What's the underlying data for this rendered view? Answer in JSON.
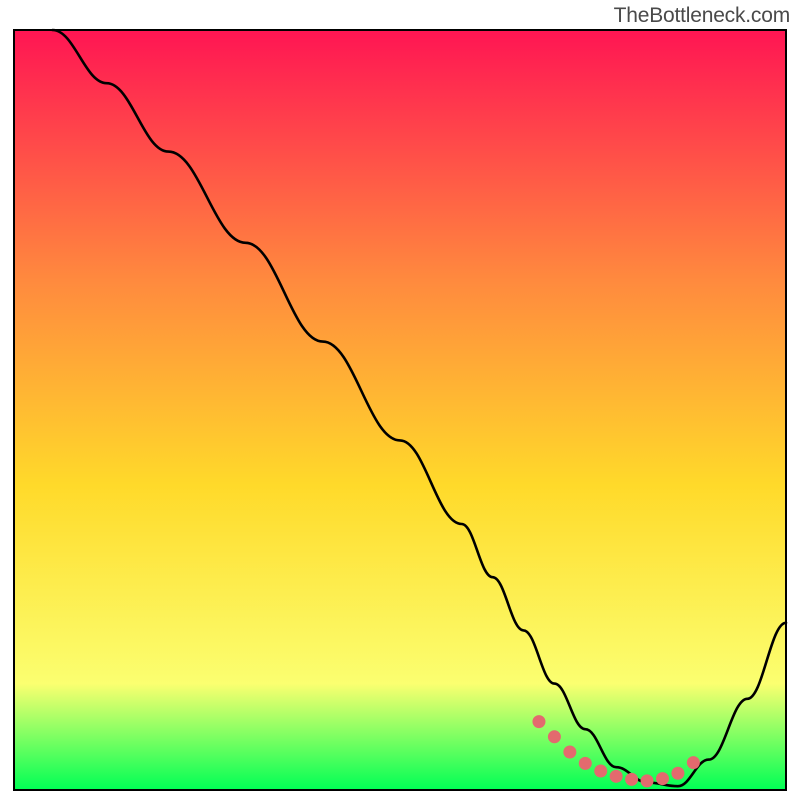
{
  "watermark": "TheBottleneck.com",
  "colors": {
    "curve_stroke": "#000000",
    "dotted_stroke": "#e36a6e",
    "gradient": {
      "top": "#ff1553",
      "upper_mid": "#ff8a3e",
      "mid": "#ffda2a",
      "lower_mid": "#fbff70",
      "bottom": "#00ff55"
    },
    "plot_border": "#000000",
    "page_bg": "#ffffff"
  },
  "chart_data": {
    "type": "line",
    "title": "",
    "xlabel": "",
    "ylabel": "",
    "xlim": [
      0,
      100
    ],
    "ylim": [
      0,
      100
    ],
    "grid": false,
    "legend": false,
    "series": [
      {
        "name": "bottleneck-curve",
        "x": [
          5,
          12,
          20,
          30,
          40,
          50,
          58,
          62,
          66,
          70,
          74,
          78,
          82,
          86,
          90,
          95,
          100
        ],
        "y": [
          100,
          93,
          84,
          72,
          59,
          46,
          35,
          28,
          21,
          14,
          8,
          3,
          1,
          0.5,
          4,
          12,
          22
        ]
      }
    ],
    "highlight": {
      "name": "optimal-range-dots",
      "x": [
        68,
        70,
        72,
        74,
        76,
        78,
        80,
        82,
        84,
        86,
        88
      ],
      "y": [
        9,
        7,
        5,
        3.5,
        2.5,
        1.8,
        1.4,
        1.2,
        1.5,
        2.2,
        3.6
      ]
    }
  }
}
